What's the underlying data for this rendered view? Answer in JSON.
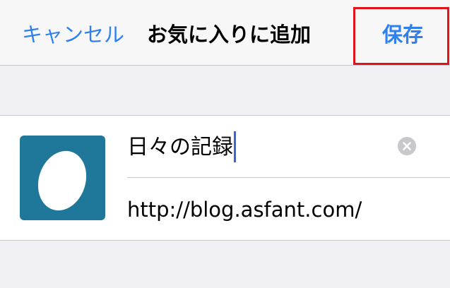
{
  "navbar": {
    "cancel_label": "キャンセル",
    "title": "お気に入りに追加",
    "save_label": "保存"
  },
  "bookmark": {
    "title_value": "日々の記録",
    "url_value": "http://blog.asfant.com/",
    "thumbnail_color": "#1f7799"
  },
  "colors": {
    "accent": "#2f80ed",
    "highlight_box": "#e2141b"
  },
  "icons": {
    "clear": "clear-circle-x-icon"
  }
}
